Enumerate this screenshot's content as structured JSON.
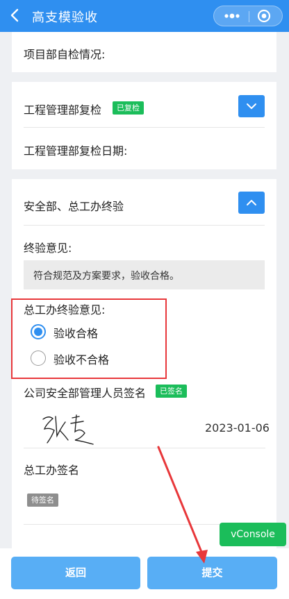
{
  "nav": {
    "title": "高支模验收"
  },
  "sections": {
    "project_self_check_label": "项目部自检情况:",
    "engineering": {
      "title": "工程管理部复检",
      "badge": "已复检",
      "date_label": "工程管理部复检日期:"
    },
    "safety": {
      "title": "安全部、总工办终验",
      "final_opinion_label": "终验意见:",
      "final_opinion_text": "符合规范及方案要求，验收合格。",
      "chief_opinion_label": "总工办终验意见:",
      "options": [
        {
          "label": "验收合格",
          "selected": true
        },
        {
          "label": "验收不合格",
          "selected": false
        }
      ],
      "safety_manager_sign_label": "公司安全部管理人员签名",
      "safety_manager_sign_badge": "已签名",
      "sign_date": "2023-01-06",
      "chief_sign_label": "总工办签名",
      "chief_sign_badge": "待签名"
    }
  },
  "vconsole": "vConsole",
  "buttons": {
    "back": "返回",
    "submit": "提交"
  },
  "colors": {
    "primary": "#2f8ff0",
    "success": "#1bbd5a",
    "highlight": "#e8373a",
    "button": "#58aef5"
  }
}
